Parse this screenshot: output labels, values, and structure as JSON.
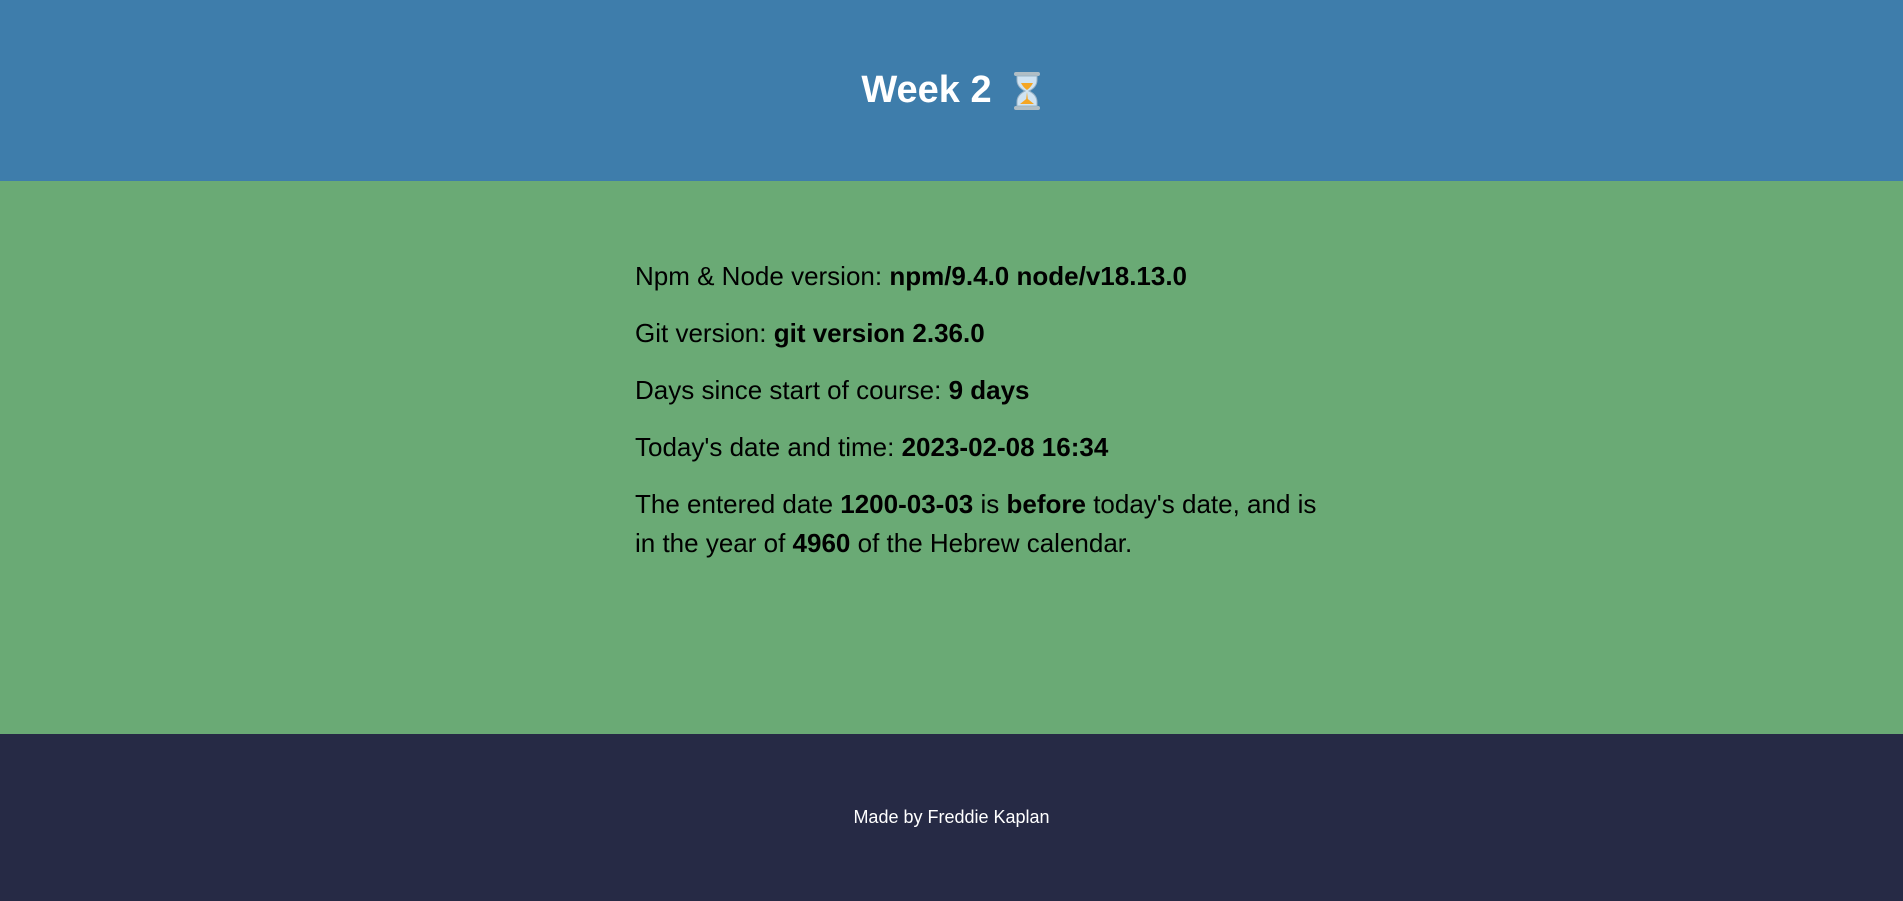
{
  "header": {
    "title": "Week 2",
    "icon": "hourglass-icon",
    "background": "#3e7dab"
  },
  "main": {
    "background": "#6aaa75",
    "npm_node": {
      "label": "Npm & Node version: ",
      "value": "npm/9.4.0 node/v18.13.0"
    },
    "git": {
      "label": "Git version: ",
      "value": "git version 2.36.0"
    },
    "days": {
      "label": "Days since start of course: ",
      "value": "9 days"
    },
    "today": {
      "label": "Today's date and time: ",
      "value": "2023-02-08 16:34"
    },
    "entered": {
      "prefix": "The entered date ",
      "date": "1200-03-03",
      "is": " is ",
      "relation": "before",
      "middle": " today's date, and is in the year of ",
      "hebrew_year": "4960",
      "suffix": " of the Hebrew calendar."
    }
  },
  "footer": {
    "text": "Made by Freddie Kaplan",
    "background": "#262a45"
  }
}
